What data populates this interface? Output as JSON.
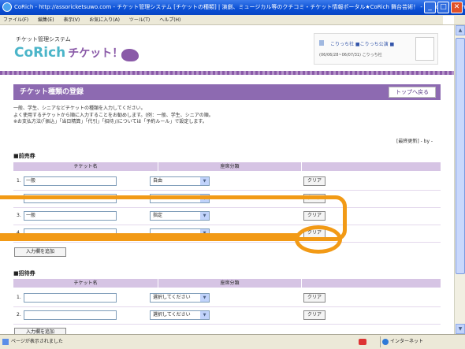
{
  "window": {
    "title": "CoRich - http://assoricketsuwo.com - チケット管理システム [チケットの種類] | 演劇、ミュージカル等のクチコミ・チケット情報ポータル★CoRich 舞台芸術！ - Microsoft Internet Explorer",
    "minimize": "_",
    "maximize": "□",
    "close": "✕"
  },
  "menubar": {
    "items": [
      "ファイル(F)",
      "編集(E)",
      "表示(V)",
      "お気に入り(A)",
      "ツール(T)",
      "ヘルプ(H)"
    ]
  },
  "header": {
    "system_name": "チケット管理システム",
    "logo_co": "CoRich",
    "logo_ticket": "チケット！",
    "user_links": "こりっち社 ■こりっち公演 ■",
    "user_detail": "(06/06/28~06/07/31) こりっち社"
  },
  "page": {
    "title": "チケット種類の登録",
    "top_button": "トップへ戻る",
    "intro_lines": [
      "一般、学生、シニアなどチケットの種類を入力してください。",
      "よく使用するチケットから順に入力することをお勧めします。(例：一般、学生、シニアの順。",
      "※お支払方法(「振込」「当日精算」「代引」「招待」)については「予約ルール」で設定します。"
    ],
    "sort_info": "[最終更新] - by -"
  },
  "presale": {
    "heading": "■前売券",
    "col_name": "チケット名",
    "col_seat": "座席分類",
    "rows": [
      {
        "num": "1.",
        "name": "一般",
        "seat": "自由",
        "clear": "クリア"
      },
      {
        "num": "2.",
        "name": "",
        "seat": "",
        "clear": "クリア"
      },
      {
        "num": "3.",
        "name": "一般",
        "seat": "指定",
        "clear": "クリア"
      },
      {
        "num": "4.",
        "name": "",
        "seat": "",
        "clear": "クリア"
      }
    ],
    "add_button": "入力欄を追加"
  },
  "invite": {
    "heading": "■招待券",
    "col_name": "チケット名",
    "col_seat": "座席分類",
    "rows": [
      {
        "num": "1.",
        "name": "",
        "seat": "選択してください",
        "clear": "クリア"
      },
      {
        "num": "2.",
        "name": "",
        "seat": "選択してください",
        "clear": "クリア"
      }
    ],
    "add_button": "入力欄を追加"
  },
  "statusbar": {
    "text": "ページが表示されました",
    "zone": "インターネット"
  },
  "colors": {
    "accent": "#8d6ab1",
    "highlight": "#f29a16",
    "logo_blue": "#4bb5c9"
  }
}
